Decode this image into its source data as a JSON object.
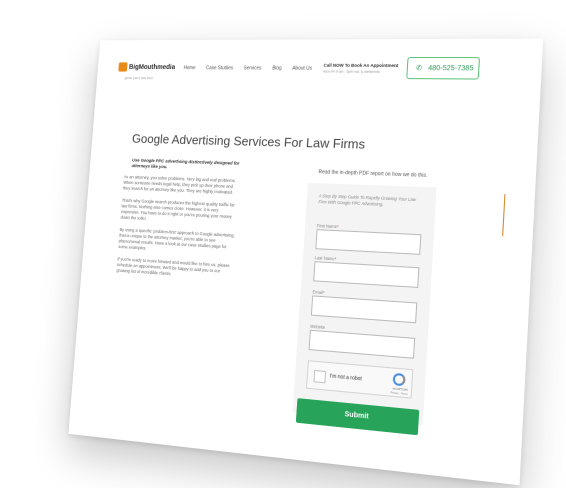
{
  "header": {
    "logo_brand": "BigMouthmedia",
    "logo_accent": "",
    "logo_tagline": "grow your law firm",
    "nav": [
      "Home",
      "Case Studies",
      "Services",
      "Blog",
      "About Us"
    ],
    "appointment_label": "Call NOW To Book An Appointment",
    "appointment_sub": "Mon-Fri 9 am - 5pm est. & weekends",
    "phone": "480-525-7385",
    "phone_icon": "phone-icon"
  },
  "page": {
    "title": "Google Advertising Services For Law Firms",
    "lead": "Use Google PPC advertising distinctively designed for attorneys like you.",
    "paragraphs": [
      "As an attorney, you solve problems. Very big and real problems. When someone needs legal help, they pick up their phone and they search for an attorney like you. They are highly motivated.",
      "That's why Google search produces the highest quality traffic for law firms. Nothing else comes close. However, it is very expensive. You have to do it right or you're pouring your money down the toilet.",
      "By using a specific 'problem-first' approach to Google advertising, that is unique to the attorney market, you're able to see phenomenal results. Have a look at our case studies page for some examples.",
      "If you're ready to move forward and would like to hire us, please schedule an appointment. We'll be happy to add you to our growing list of incredible clients."
    ]
  },
  "form": {
    "report_heading": "Read the in-depth PDF report on how we do this.",
    "intro": "A Step By Step Guide To Rapidly Growing Your Law Firm With Google PPC Advertising.",
    "fields": [
      {
        "label": "First Name",
        "required": "*"
      },
      {
        "label": "Last Name",
        "required": "*"
      },
      {
        "label": "Email",
        "required": "*"
      },
      {
        "label": "Website",
        "required": ""
      }
    ],
    "recaptcha_text": "I'm not a robot",
    "recaptcha_brand": "reCAPTCHA",
    "recaptcha_terms": "Privacy - Terms",
    "submit_label": "Submit"
  },
  "colors": {
    "accent_green": "#27a35a",
    "logo_orange": "#e88b1a"
  }
}
